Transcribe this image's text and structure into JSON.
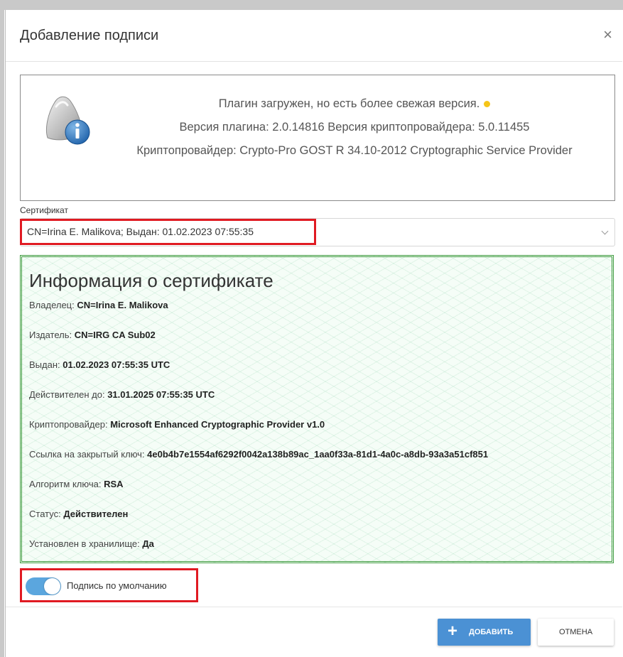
{
  "dialog": {
    "title": "Добавление подписи",
    "close_icon": "×"
  },
  "plugin": {
    "icon": "info-badge-icon",
    "status": "Плагин загружен, но есть более свежая версия.",
    "status_dot_color": "#f5c518",
    "versions": "Версия плагина: 2.0.14816 Версия криптопровайдера: 5.0.11455",
    "provider": "Криптопровайдер: Crypto-Pro GOST R 34.10-2012 Cryptographic Service Provider"
  },
  "certificate": {
    "label": "Сертификат",
    "selected": "CN=Irina E. Malikova; Выдан: 01.02.2023 07:55:35"
  },
  "info": {
    "title": "Информация о сертификате",
    "rows": [
      {
        "label": "Владелец:",
        "value": "CN=Irina E. Malikova"
      },
      {
        "label": "Издатель:",
        "value": "CN=IRG CA Sub02"
      },
      {
        "label": "Выдан:",
        "value": "01.02.2023 07:55:35 UTC"
      },
      {
        "label": "Действителен до:",
        "value": "31.01.2025 07:55:35 UTC"
      },
      {
        "label": "Криптопровайдер:",
        "value": "Microsoft Enhanced Cryptographic Provider v1.0"
      },
      {
        "label": "Ссылка на закрытый ключ:",
        "value": "4e0b4b7e1554af6292f0042a138b89ac_1aa0f33a-81d1-4a0c-a8db-93a3a51cf851"
      },
      {
        "label": "Алгоритм ключа:",
        "value": "RSA"
      },
      {
        "label": "Статус:",
        "value": "Действителен"
      },
      {
        "label": "Установлен в хранилище:",
        "value": "Да"
      }
    ]
  },
  "default_signature": {
    "label": "Подпись по умолчанию",
    "checked": true
  },
  "buttons": {
    "add_icon": "+",
    "add": "ДОБАВИТЬ",
    "cancel": "ОТМЕНА"
  },
  "colors": {
    "accent": "#4b91d4",
    "highlight": "#e01a22",
    "panel_border": "#3f9b3f"
  }
}
